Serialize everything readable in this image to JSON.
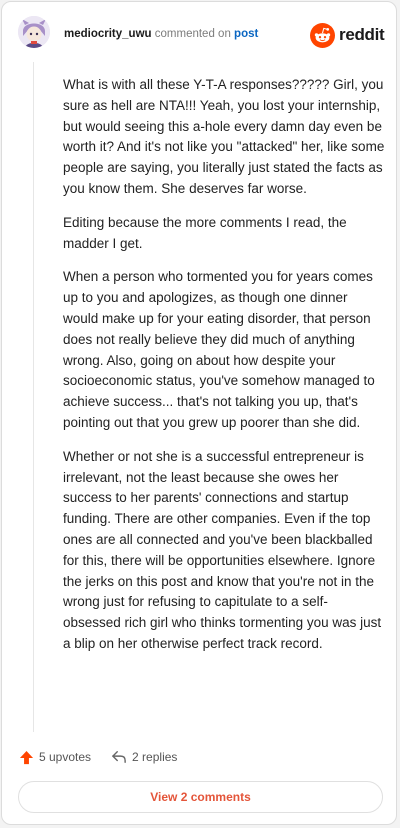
{
  "comment": {
    "username": "mediocrity_uwu",
    "action_text": "commented on",
    "target_link": "post",
    "paragraphs": [
      "What is with all these Y-T-A responses????? Girl, you sure as hell are NTA!!! Yeah, you lost your internship, but would seeing this a-hole every damn day even be worth it? And it's not like you \"attacked\" her, like some people are saying, you literally just stated the facts as you know them. She deserves far worse.",
      "Editing because the more comments I read, the madder I get.",
      "When a person who tormented you for years comes up to you and apologizes, as though one dinner would make up for your eating disorder, that person does not really believe they did much of anything wrong. Also, going on about how despite your socioeconomic status, you've somehow managed to achieve success... that's not talking you up, that's pointing out that you grew up poorer than she did.",
      "Whether or not she is a successful entrepreneur is irrelevant, not the least because she owes her success to her parents' connections and startup funding. There are other companies. Even if the top ones are all connected and you've been blackballed for this, there will be opportunities elsewhere. Ignore the jerks on this post and know that you're not in the wrong just for refusing to capitulate to a self-obsessed rich girl who thinks tormenting you was just a blip on her otherwise perfect track record."
    ],
    "upvotes_label": "5 upvotes",
    "replies_label": "2 replies"
  },
  "brand": {
    "wordmark": "reddit",
    "icon": "reddit-logo-icon",
    "accent_color": "#ff4500"
  },
  "footer": {
    "view_comments_label": "View 2 comments"
  },
  "colors": {
    "link": "#0a66c2",
    "upvote_arrow": "#ff4500",
    "view_comments_text": "#e4553a"
  }
}
